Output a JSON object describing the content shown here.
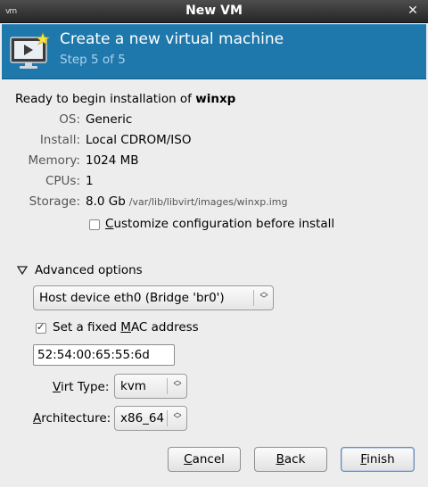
{
  "window": {
    "title": "New VM"
  },
  "header": {
    "title": "Create a new virtual machine",
    "step": "Step 5 of 5"
  },
  "summary": {
    "ready_prefix": "Ready to begin installation of",
    "vm_name": "winxp",
    "rows": {
      "os": {
        "label": "OS:",
        "value": "Generic"
      },
      "install": {
        "label": "Install:",
        "value": "Local CDROM/ISO"
      },
      "memory": {
        "label": "Memory:",
        "value": "1024 MB"
      },
      "cpus": {
        "label": "CPUs:",
        "value": "1"
      },
      "storage": {
        "label": "Storage:",
        "value": "8.0 Gb",
        "path": "/var/lib/libvirt/images/winxp.img"
      }
    },
    "customize": {
      "label_pre": "",
      "label_mn": "C",
      "label_post": "ustomize configuration before install",
      "checked": false
    }
  },
  "advanced": {
    "expander_label": "Advanced options",
    "network": {
      "value": "Host device eth0 (Bridge 'br0')"
    },
    "fixed_mac": {
      "label_pre": "Set a fixed ",
      "label_mn": "M",
      "label_post": "AC address",
      "checked": true
    },
    "mac_value": "52:54:00:65:55:6d",
    "virt_type": {
      "label_pre": "",
      "label_mn": "V",
      "label_post": "irt Type:",
      "value": "kvm"
    },
    "architecture": {
      "label_pre": "",
      "label_mn": "A",
      "label_post": "rchitecture:",
      "value": "x86_64"
    }
  },
  "buttons": {
    "cancel": {
      "mn": "C",
      "rest": "ancel"
    },
    "back": {
      "mn": "B",
      "rest": "ack"
    },
    "finish": {
      "mn": "F",
      "rest": "inish"
    }
  },
  "icons": {
    "window_menu": "window-menu-icon",
    "close": "close-icon",
    "header": "monitor-new-star-icon",
    "expander": "triangle-down-icon",
    "combo": "up-down-arrows-icon"
  },
  "colors": {
    "banner": "#1f78ab",
    "step_text": "#a9d3ee"
  }
}
